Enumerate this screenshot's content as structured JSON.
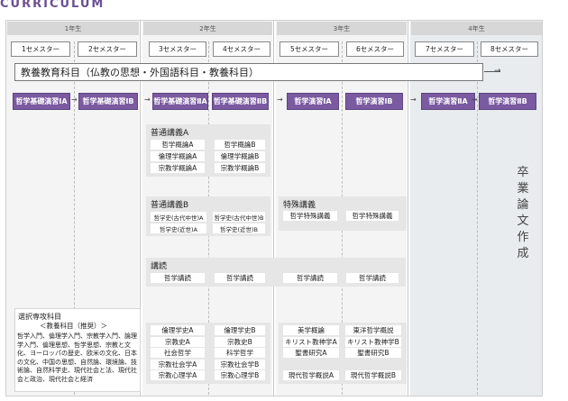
{
  "title": "CURRICULUM",
  "years": [
    "1年生",
    "2年生",
    "3年生",
    "4年生"
  ],
  "semesters": [
    "1セメスター",
    "2セメスター",
    "3セメスター",
    "4セメスター",
    "5セメスター",
    "6セメスター",
    "7セメスター",
    "8セメスター"
  ],
  "general": "教養教育科目（仏教の思想・外国語科目・教養科目）",
  "practicum": [
    "哲学基礎演習ⅠA",
    "哲学基礎演習ⅠB",
    "哲学基礎演習ⅡA",
    "哲学基礎演習ⅡB",
    "哲学演習ⅠA",
    "哲学演習ⅠB",
    "哲学演習ⅡA",
    "哲学演習ⅡB"
  ],
  "arrow": "→",
  "thesis": "卒業論文作成",
  "futsuu": {
    "title": "普通講義A",
    "col3": [
      "哲学概論A",
      "倫理学概論A",
      "宗教学概論A"
    ],
    "col4": [
      "哲学概論B",
      "倫理学概論B",
      "宗教学概論B"
    ]
  },
  "futsuuB": {
    "title": "普通講義B",
    "col3": [
      "哲学史(古代中世)A",
      "哲学史(近世)A"
    ],
    "col4": [
      "哲学史(古代中世)B",
      "哲学史(近世)B"
    ]
  },
  "tokushu": {
    "title": "特殊講義",
    "col5": "哲学特殊講義",
    "col6": "哲学特殊講義"
  },
  "koudoku": {
    "title": "講読",
    "items": [
      "哲学講読",
      "哲学講読",
      "哲学講読",
      "哲学講読"
    ]
  },
  "elective": {
    "title": "選択専攻科目",
    "subtitle": "＜教養科目（推奨）＞",
    "body": "哲学入門、倫理学入門、宗教学入門、論理学入門、倫理思想、哲学思想、宗教と文化、ヨーロッパの歴史、欧米の文化、日本の文化、中国の思想、自然論、環境論、技術論、自然科学史、現代社会と法、現代社会と政治、現代社会と経済",
    "col3": [
      "倫理学史A",
      "宗教史A",
      "社会哲学",
      "宗教社会学A",
      "宗教心理学A"
    ],
    "col4": [
      "倫理学史B",
      "宗教史B",
      "科学哲学",
      "宗教社会学B",
      "宗教心理学B"
    ],
    "col5": [
      "美学概論",
      "キリスト教神学A",
      "聖書研究A",
      "現代哲学概説A"
    ],
    "col6": [
      "東洋哲学概説",
      "キリスト教神学B",
      "聖書研究B",
      "現代哲学概説B"
    ]
  }
}
